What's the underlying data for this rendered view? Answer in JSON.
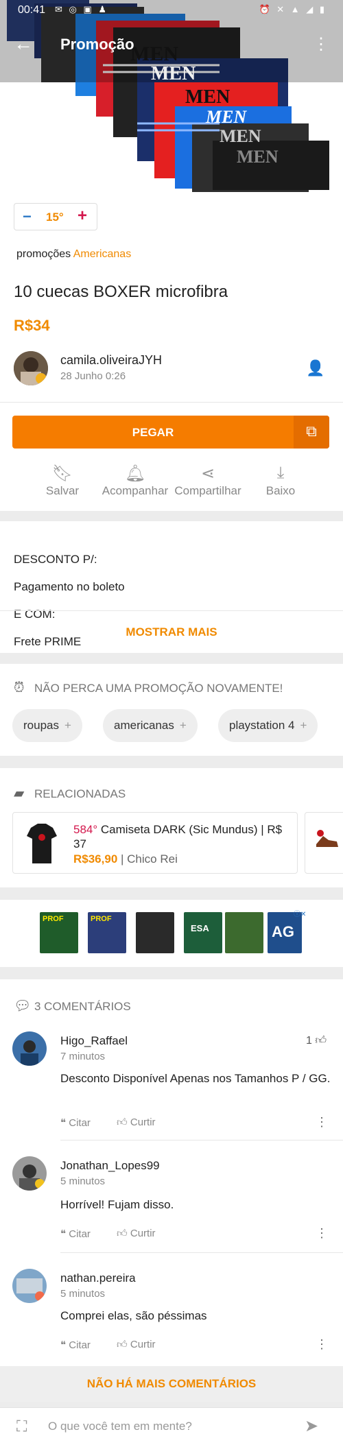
{
  "status_bar": {
    "time": "00:41",
    "left_icons": "✉ ◎ ▣ ♟",
    "right_icons": "⏰ ✕ ▲ ◢ ▮"
  },
  "app_bar": {
    "title": "Promoção"
  },
  "hero": {
    "brand_text": "MEN"
  },
  "temperature": {
    "value": "15°"
  },
  "store": {
    "prefix": "promoções",
    "name": "Americanas"
  },
  "deal": {
    "title": "10 cuecas BOXER microfibra",
    "price": "R$34"
  },
  "author": {
    "name": "camila.oliveiraJYH",
    "date": "28 Junho 0:26"
  },
  "cta": {
    "label": "PEGAR"
  },
  "actions": [
    {
      "label": "Salvar"
    },
    {
      "label": "Acompanhar"
    },
    {
      "label": "Compartilhar"
    },
    {
      "label": "Baixo"
    }
  ],
  "description": {
    "lines": [
      "DESCONTO P/:",
      "Pagamento no boleto",
      "E COM:",
      "Frete PRIME"
    ],
    "show_more": "MOSTRAR MAIS"
  },
  "alerts": {
    "heading": "NÃO PERCA UMA PROMOÇÃO NOVAMENTE!",
    "chips": [
      "roupas",
      "americanas",
      "playstation 4"
    ]
  },
  "related": {
    "heading": "RELACIONADAS",
    "item": {
      "temp": "584°",
      "title": "Camiseta DARK (Sic Mundus) | R$ 37",
      "price": "R$36,90",
      "store": "Chico Rei"
    }
  },
  "ad": {
    "badge": "AG",
    "labels": [
      "PROF",
      "PROF",
      "ESA"
    ]
  },
  "comments": {
    "heading": "3 COMENTÁRIOS",
    "items": [
      {
        "user": "Higo_Raffael",
        "time": "7 minutos",
        "text": "Desconto Disponível Apenas nos Tamanhos P / GG.",
        "likes": "1"
      },
      {
        "user": "Jonathan_Lopes99",
        "time": "5 minutos",
        "text": "Horrível! Fujam disso.",
        "likes": ""
      },
      {
        "user": "nathan.pereira",
        "time": "5 minutos",
        "text": "Comprei elas, são péssimas",
        "likes": ""
      }
    ],
    "quote_label": "Citar",
    "like_label": "Curtir",
    "no_more": "NÃO HÁ MAIS COMENTÁRIOS"
  },
  "composer": {
    "placeholder": "O que você tem em mente?"
  },
  "colors": {
    "accent": "#f57c00",
    "hot": "#d3174c",
    "cold": "#2b78c5"
  }
}
